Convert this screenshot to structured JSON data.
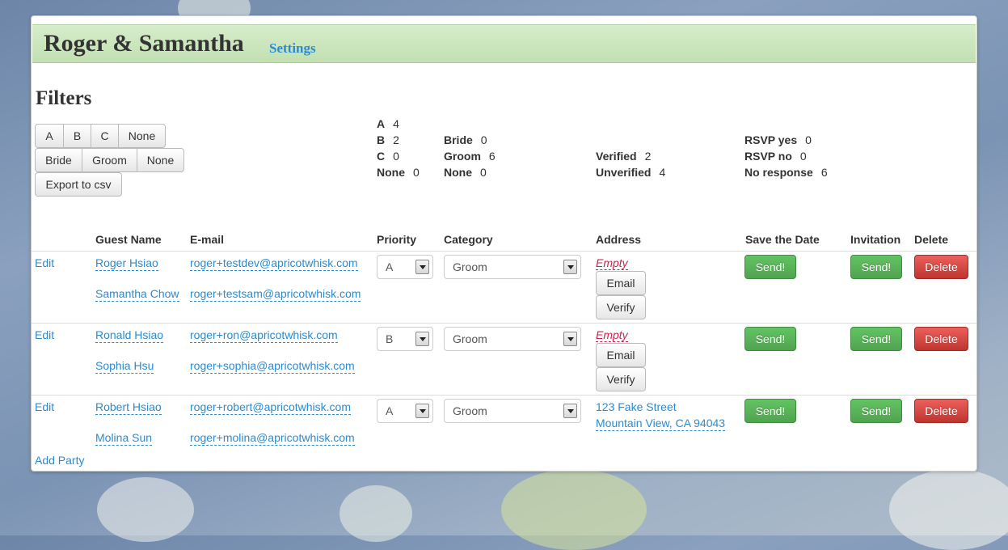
{
  "header": {
    "title": "Roger & Samantha",
    "settings_label": "Settings"
  },
  "filters": {
    "title": "Filters",
    "priority_buttons": [
      "A",
      "B",
      "C",
      "None"
    ],
    "category_buttons": [
      "Bride",
      "Groom",
      "None"
    ],
    "export_label": "Export to csv"
  },
  "stats": {
    "priority": [
      {
        "label": "A",
        "value": "4"
      },
      {
        "label": "B",
        "value": "2"
      },
      {
        "label": "C",
        "value": "0"
      },
      {
        "label": "None",
        "value": "0"
      }
    ],
    "category": [
      {
        "label": "Bride",
        "value": "0"
      },
      {
        "label": "Groom",
        "value": "6"
      },
      {
        "label": "None",
        "value": "0"
      }
    ],
    "verification": [
      {
        "label": "Verified",
        "value": "2"
      },
      {
        "label": "Unverified",
        "value": "4"
      }
    ],
    "rsvp": [
      {
        "label": "RSVP yes",
        "value": "0"
      },
      {
        "label": "RSVP no",
        "value": "0"
      },
      {
        "label": "No response",
        "value": "6"
      }
    ]
  },
  "table": {
    "headers": [
      "Guest Name",
      "E-mail",
      "Priority",
      "Category",
      "Address",
      "Save the Date",
      "Invitation",
      "Delete"
    ],
    "edit_label": "Edit",
    "send_label": "Send!",
    "delete_label": "Delete",
    "email_label": "Email",
    "verify_label": "Verify",
    "empty_label": "Empty",
    "parties": [
      {
        "guests": [
          {
            "name": "Roger Hsiao",
            "email": "roger+testdev@apricotwhisk.com"
          },
          {
            "name": "Samantha Chow",
            "email": "roger+testsam@apricotwhisk.com"
          }
        ],
        "priority": "A",
        "category": "Groom",
        "address": []
      },
      {
        "guests": [
          {
            "name": "Ronald Hsiao",
            "email": "roger+ron@apricotwhisk.com"
          },
          {
            "name": "Sophia Hsu",
            "email": "roger+sophia@apricotwhisk.com"
          }
        ],
        "priority": "B",
        "category": "Groom",
        "address": []
      },
      {
        "guests": [
          {
            "name": "Robert Hsiao",
            "email": "roger+robert@apricotwhisk.com"
          },
          {
            "name": "Molina Sun",
            "email": "roger+molina@apricotwhisk.com"
          }
        ],
        "priority": "A",
        "category": "Groom",
        "address": [
          "123 Fake Street",
          "Mountain View, CA 94043"
        ]
      }
    ],
    "add_party_label": "Add Party"
  }
}
